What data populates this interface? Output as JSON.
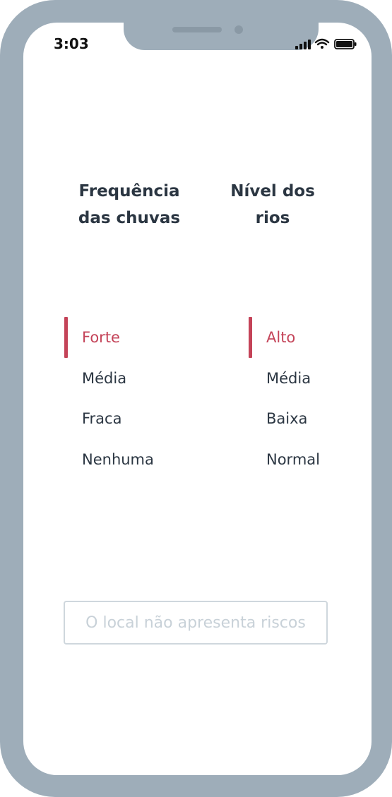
{
  "status_bar": {
    "time": "3:03"
  },
  "rain_frequency": {
    "title": "Frequência das chuvas",
    "selected_index": 0,
    "options": [
      "Forte",
      "Média",
      "Fraca",
      "Nenhuma"
    ]
  },
  "river_level": {
    "title": "Nível dos rios",
    "selected_index": 0,
    "options": [
      "Alto",
      "Média",
      "Baixa",
      "Normal"
    ]
  },
  "result": {
    "text": "O local não apresenta riscos"
  },
  "colors": {
    "accent": "#c44358",
    "text": "#2b3642",
    "frame": "#9eadb9",
    "muted": "#c8d1d8"
  }
}
